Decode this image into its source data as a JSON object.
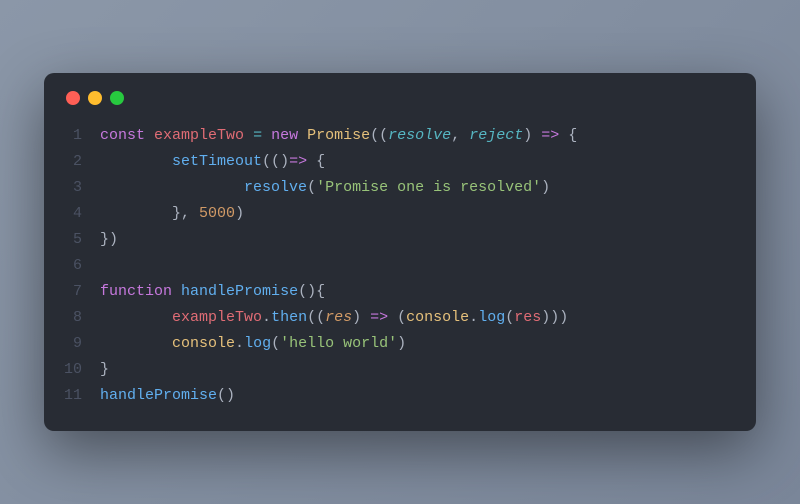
{
  "window": {
    "traffic_lights": [
      "close",
      "minimize",
      "zoom"
    ]
  },
  "gutter": [
    "1",
    "2",
    "3",
    "4",
    "5",
    "6",
    "7",
    "8",
    "9",
    "10",
    "11"
  ],
  "code": {
    "l1": {
      "kw1": "const",
      "var1": "exampleTwo",
      "op": "=",
      "kw2": "new",
      "cls": "Promise",
      "p1": "resolve",
      "comma": ", ",
      "p2": "reject",
      "arrow": "=>",
      "brace": "{"
    },
    "l2": {
      "indent": "        ",
      "fn": "setTimeout",
      "open": "((",
      "close": ")",
      "arrow": "=>",
      "brace": " {"
    },
    "l3": {
      "indent": "                ",
      "fn": "resolve",
      "open": "(",
      "str": "'Promise one is resolved'",
      "close": ")"
    },
    "l4": {
      "indent": "        ",
      "close": "}, ",
      "num": "5000",
      "paren": ")"
    },
    "l5": {
      "text": "})"
    },
    "l6": {
      "text": ""
    },
    "l7": {
      "kw": "function",
      "name": "handlePromise",
      "parens": "(){",
      "brace": ""
    },
    "l8": {
      "indent": "        ",
      "obj": "exampleTwo",
      "dot": ".",
      "fn": "then",
      "open": "((",
      "param": "res",
      "close": ") ",
      "arrow": "=>",
      "open2": " (",
      "cons": "console",
      "dot2": ".",
      "log": "log",
      "open3": "(",
      "arg": "res",
      "close3": ")))"
    },
    "l9": {
      "indent": "        ",
      "cons": "console",
      "dot": ".",
      "log": "log",
      "open": "(",
      "str": "'hello world'",
      "close": ")"
    },
    "l10": {
      "text": "}"
    },
    "l11": {
      "fn": "handlePromise",
      "parens": "()"
    }
  }
}
